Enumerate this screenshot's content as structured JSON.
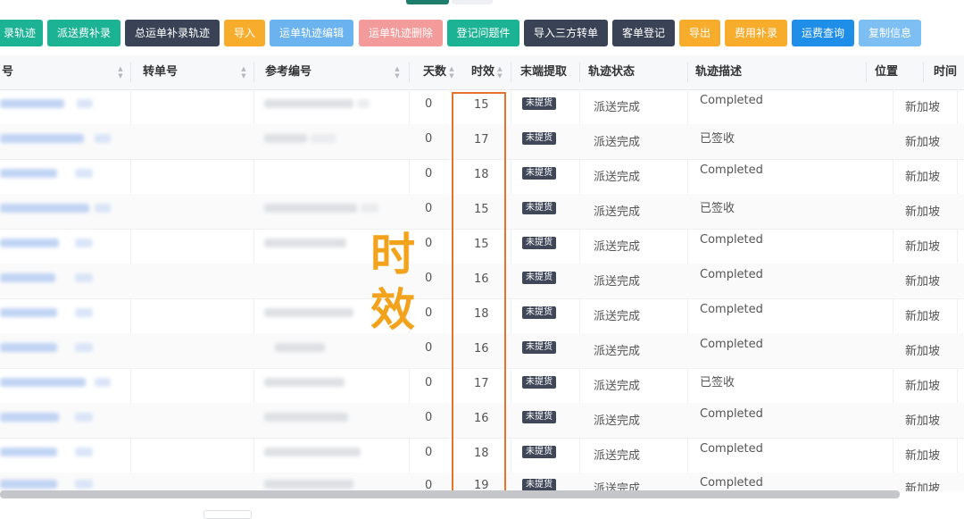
{
  "toolbar": {
    "buttons": [
      {
        "label": "录轨迹",
        "color": "#1bb394"
      },
      {
        "label": "派送费补录",
        "color": "#1bb394"
      },
      {
        "label": "总运单补录轨迹",
        "color": "#3a4356"
      },
      {
        "label": "导入",
        "color": "#f8ac2b"
      },
      {
        "label": "运单轨迹编辑",
        "color": "#6ab3ee"
      },
      {
        "label": "运单轨迹删除",
        "color": "#f39a9a"
      },
      {
        "label": "登记问题件",
        "color": "#1bb394"
      },
      {
        "label": "导入三方转单",
        "color": "#3a4356"
      },
      {
        "label": "客单登记",
        "color": "#3a4356"
      },
      {
        "label": "导出",
        "color": "#f8ac2b"
      },
      {
        "label": "费用补录",
        "color": "#f8ac2b"
      },
      {
        "label": "运费查询",
        "color": "#1f8ee8"
      },
      {
        "label": "复制信息",
        "color": "#7dbff2"
      }
    ]
  },
  "table": {
    "headers": {
      "waybill": "号",
      "transfer": "转单号",
      "reference": "参考编号",
      "days": "天数",
      "timeliness": "时效",
      "last_mile": "末端提取",
      "track_status": "轨迹状态",
      "track_desc": "轨迹描述",
      "location": "位置",
      "time": "时间"
    },
    "badge_label": "未提货",
    "rows": [
      {
        "days": "0",
        "timeliness": "15",
        "status": "派送完成",
        "desc": "Completed",
        "location": "新加坡"
      },
      {
        "days": "0",
        "timeliness": "17",
        "status": "派送完成",
        "desc": "已签收",
        "location": "新加坡"
      },
      {
        "days": "0",
        "timeliness": "18",
        "status": "派送完成",
        "desc": "Completed",
        "location": "新加坡"
      },
      {
        "days": "0",
        "timeliness": "15",
        "status": "派送完成",
        "desc": "已签收",
        "location": "新加坡"
      },
      {
        "days": "0",
        "timeliness": "15",
        "status": "派送完成",
        "desc": "Completed",
        "location": "新加坡"
      },
      {
        "days": "0",
        "timeliness": "16",
        "status": "派送完成",
        "desc": "Completed",
        "location": "新加坡"
      },
      {
        "days": "0",
        "timeliness": "18",
        "status": "派送完成",
        "desc": "Completed",
        "location": "新加坡"
      },
      {
        "days": "0",
        "timeliness": "16",
        "status": "派送完成",
        "desc": "Completed",
        "location": "新加坡"
      },
      {
        "days": "0",
        "timeliness": "17",
        "status": "派送完成",
        "desc": "已签收",
        "location": "新加坡"
      },
      {
        "days": "0",
        "timeliness": "16",
        "status": "派送完成",
        "desc": "Completed",
        "location": "新加坡"
      },
      {
        "days": "0",
        "timeliness": "18",
        "status": "派送完成",
        "desc": "Completed",
        "location": "新加坡"
      },
      {
        "days": "0",
        "timeliness": "19",
        "status": "派送完成",
        "desc": "Completed",
        "location": "新加坡"
      }
    ]
  },
  "annotation": {
    "char1": "时",
    "char2": "效",
    "highlight_color": "#e8722a",
    "text_color": "#f2a31b"
  }
}
